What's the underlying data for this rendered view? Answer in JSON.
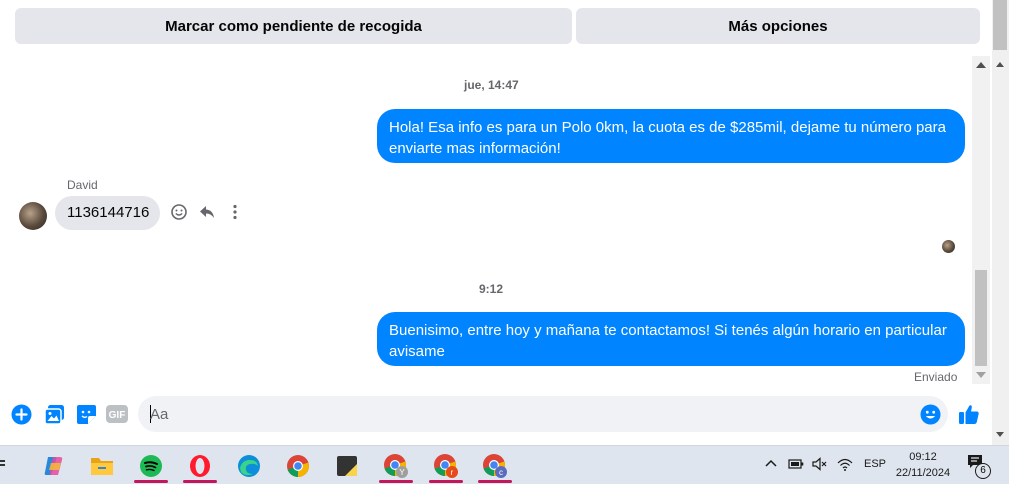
{
  "header": {
    "mark_pickup_label": "Marcar como pendiente de recogida",
    "more_options_label": "Más opciones"
  },
  "conversation": {
    "timestamp_1": "jue, 14:47",
    "outgoing_1": "Hola! Esa info es para un Polo 0km, la cuota es de $285mil, dejame tu número para enviarte mas información!",
    "sender_name": "David",
    "incoming_1": "1136144716",
    "timestamp_2": "9:12",
    "outgoing_2": "Buenisimo, entre hoy y mañana te contactamos! Si tenés algún horario en particular avisame",
    "delivery_status": "Enviado"
  },
  "composer": {
    "placeholder": "Aa",
    "gif_label": "GIF"
  },
  "colors": {
    "accent": "#0084ff",
    "bubble_in": "#e4e6eb",
    "button_bg": "#e4e6eb"
  },
  "taskbar": {
    "apps": [
      "widgets-icon",
      "copilot-icon",
      "file-explorer-icon",
      "spotify-icon",
      "opera-icon",
      "edge-icon",
      "chrome-icon",
      "sticky-notes-icon",
      "chrome-profile-y-icon",
      "chrome-profile-r-icon",
      "chrome-profile-c-icon"
    ],
    "profile_y": "Y",
    "profile_r": "r",
    "profile_c": "c",
    "language": "ESP",
    "time": "09:12",
    "date": "22/11/2024",
    "notification_count": "6"
  }
}
